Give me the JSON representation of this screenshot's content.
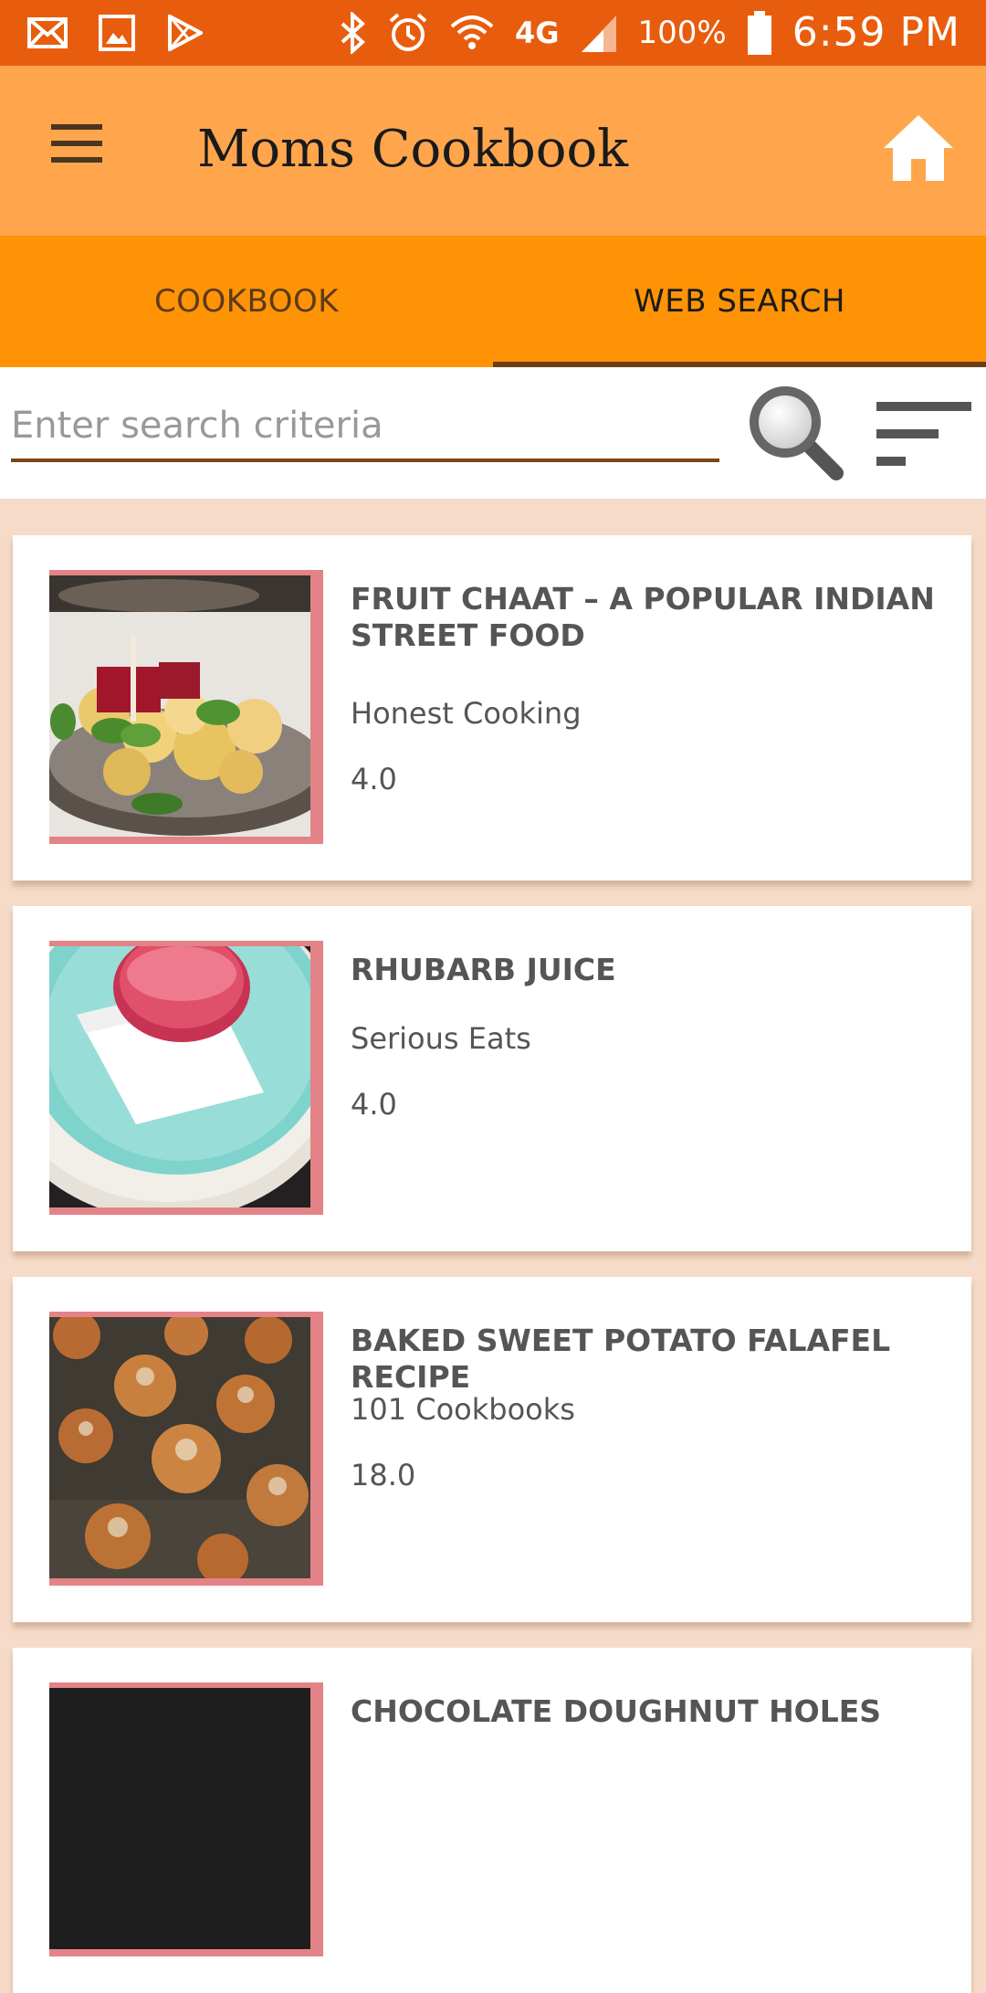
{
  "status_bar": {
    "battery_text": "100%",
    "time": "6:59 PM",
    "network": "4G"
  },
  "app_bar": {
    "title": "Moms Cookbook"
  },
  "tabs": [
    {
      "label": "COOKBOOK",
      "active": false
    },
    {
      "label": "WEB SEARCH",
      "active": true
    }
  ],
  "search": {
    "placeholder": "Enter search criteria",
    "value": ""
  },
  "recipes": [
    {
      "title": "FRUIT CHAAT – A POPULAR INDIAN STREET FOOD",
      "source": "Honest Cooking",
      "rating": "4.0"
    },
    {
      "title": "RHUBARB JUICE",
      "source": "Serious Eats",
      "rating": "4.0"
    },
    {
      "title": "BAKED SWEET POTATO FALAFEL RECIPE",
      "source": "101 Cookbooks",
      "rating": "18.0"
    },
    {
      "title": "CHOCOLATE DOUGHNUT HOLES",
      "source": "",
      "rating": ""
    }
  ],
  "colors": {
    "status_bar": "#e85d0d",
    "app_bar": "#ffa64d",
    "tab_bar": "#ff9306",
    "tab_indicator": "#6b3f16",
    "list_background": "#f6dcc8",
    "thumb_frame": "#e38387"
  }
}
